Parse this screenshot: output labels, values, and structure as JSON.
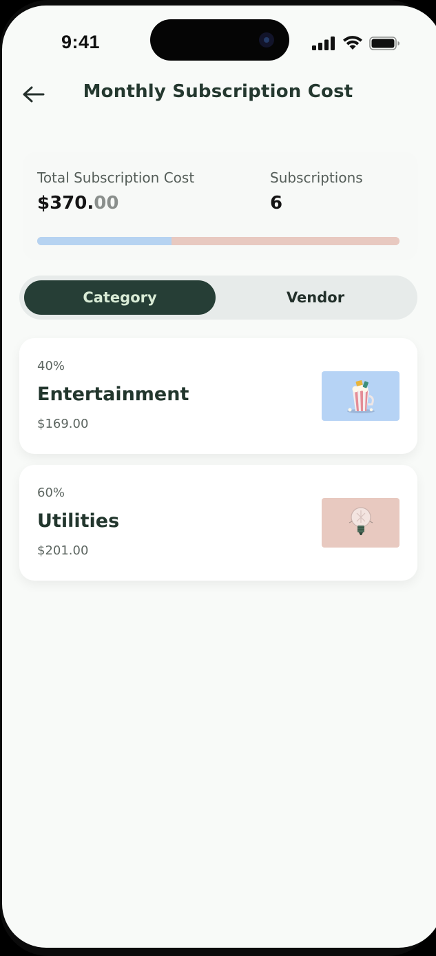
{
  "status_bar": {
    "time": "9:41"
  },
  "header": {
    "title": "Monthly Subscription Cost",
    "back_icon": "arrow-left-icon"
  },
  "summary": {
    "total_label": "Total Subscription Cost",
    "total_value_main": "$370.",
    "total_value_cents": "00",
    "count_label": "Subscriptions",
    "count_value": "6",
    "progress_split": {
      "entertainment_fraction": 0.37,
      "utilities_fraction": 0.63
    }
  },
  "tabs": {
    "category": "Category",
    "vendor": "Vendor",
    "selected": "Category"
  },
  "categories": [
    {
      "percent": "40%",
      "name": "Entertainment",
      "amount": "$169.00",
      "icon": "popcorn-icon",
      "color": "#b6d3f5"
    },
    {
      "percent": "60%",
      "name": "Utilities",
      "amount": "$201.00",
      "icon": "lightbulb-icon",
      "color": "#e8c9c0"
    }
  ],
  "colors": {
    "accent_dark": "#263e36",
    "entertainment": "#b6d3f1",
    "utilities": "#e8c9c0",
    "background": "#f8faf8"
  }
}
